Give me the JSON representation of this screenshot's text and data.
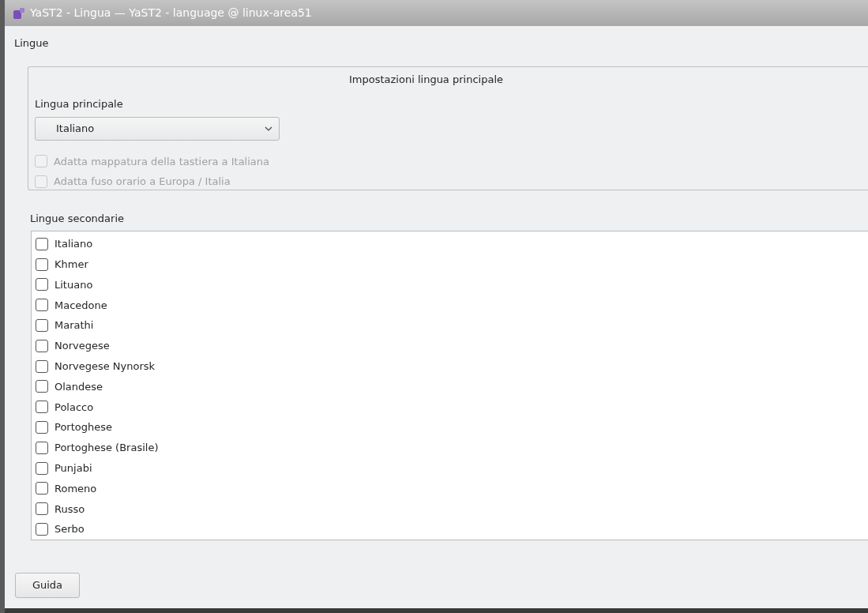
{
  "window": {
    "title": "YaST2 - Lingua — YaST2 - language @ linux-area51"
  },
  "heading": "Lingue",
  "primary": {
    "group_title": "Impostazioni lingua principale",
    "label": "Lingua principale",
    "value": "Italiano",
    "options": [
      {
        "label": "Adatta mappatura della tastiera a Italiana",
        "checked": false,
        "disabled": true
      },
      {
        "label": "Adatta fuso orario a Europa / Italia",
        "checked": false,
        "disabled": true
      }
    ]
  },
  "secondary": {
    "label": "Lingue secondarie",
    "items": [
      {
        "label": "Italiano",
        "checked": false
      },
      {
        "label": "Khmer",
        "checked": false
      },
      {
        "label": "Lituano",
        "checked": false
      },
      {
        "label": "Macedone",
        "checked": false
      },
      {
        "label": "Marathi",
        "checked": false
      },
      {
        "label": "Norvegese",
        "checked": false
      },
      {
        "label": "Norvegese Nynorsk",
        "checked": false
      },
      {
        "label": "Olandese",
        "checked": false
      },
      {
        "label": "Polacco",
        "checked": false
      },
      {
        "label": "Portoghese",
        "checked": false
      },
      {
        "label": "Portoghese (Brasile)",
        "checked": false
      },
      {
        "label": "Punjabi",
        "checked": false
      },
      {
        "label": "Romeno",
        "checked": false
      },
      {
        "label": "Russo",
        "checked": false
      },
      {
        "label": "Serbo",
        "checked": false
      }
    ]
  },
  "buttons": [
    "Guida"
  ]
}
